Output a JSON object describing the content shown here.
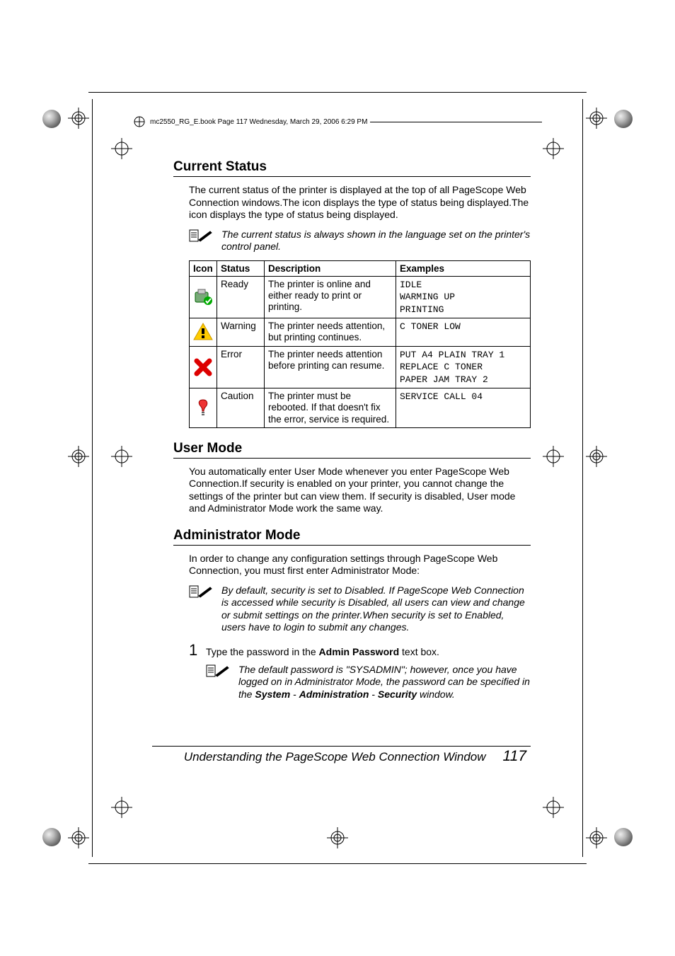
{
  "header": {
    "running": "mc2550_RG_E.book  Page 117  Wednesday, March 29, 2006  6:29 PM"
  },
  "s1": {
    "title": "Current Status",
    "intro": "The current status of the printer is displayed at the top of all PageScope Web Connection windows.The icon displays the type of status being displayed.The icon displays the type of status being displayed.",
    "note": "The current status is always shown in the language set on the printer's control panel.",
    "table": {
      "headers": {
        "icon": "Icon",
        "status": "Status",
        "desc": "Description",
        "ex": "Examples"
      },
      "rows": [
        {
          "status": "Ready",
          "desc": "The printer is online and either ready to print or printing.",
          "ex": "IDLE\nWARMING UP\nPRINTING"
        },
        {
          "status": "Warning",
          "desc": "The printer needs attention, but printing continues.",
          "ex": "C TONER LOW"
        },
        {
          "status": "Error",
          "desc": "The printer needs attention before printing can resume.",
          "ex": "PUT A4 PLAIN TRAY 1\nREPLACE C TONER\nPAPER JAM TRAY 2"
        },
        {
          "status": "Caution",
          "desc": "The printer must be rebooted. If that doesn't fix the error, service is required.",
          "ex": "SERVICE CALL 04"
        }
      ]
    }
  },
  "s2": {
    "title": "User Mode",
    "body": "You automatically enter User Mode whenever you enter PageScope Web Connection.If security is enabled on your printer, you cannot change the settings of the printer but can view them. If security is disabled, User mode and Administrator Mode work the same way."
  },
  "s3": {
    "title": "Administrator Mode",
    "intro": "In order to change any configuration settings through PageScope Web Connection, you must first enter Administrator Mode:",
    "note1": "By default, security is set to Disabled. If PageScope Web Connection is accessed while security is Disabled, all users can view and change or submit settings on the printer.When security is set to Enabled, users have to login to submit any changes.",
    "step_num": "1",
    "step_pre": "Type the password in the ",
    "step_bold": "Admin Password",
    "step_post": " text box.",
    "note2_pre": "The default password is \"SYSADMIN\"; however, once you have logged on in Administrator Mode, the password can be specified in the ",
    "note2_b1": "System",
    "note2_sep1": " - ",
    "note2_b2": "Administration",
    "note2_sep2": " - ",
    "note2_b3": "Security",
    "note2_post": " window."
  },
  "footer": {
    "title": "Understanding the PageScope Web Connection Window",
    "page": "117"
  }
}
